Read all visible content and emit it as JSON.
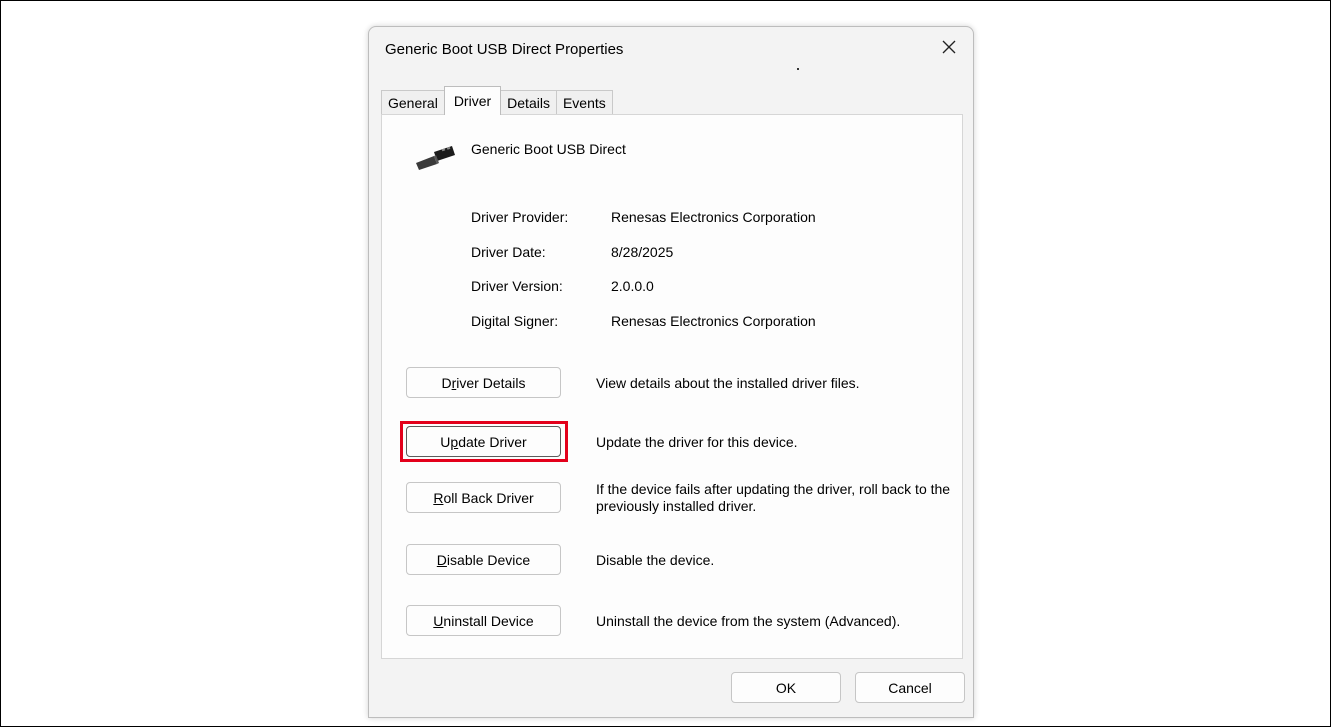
{
  "window": {
    "title": "Generic Boot USB Direct Properties"
  },
  "tabs": [
    {
      "label": "General",
      "active": false
    },
    {
      "label": "Driver",
      "active": true
    },
    {
      "label": "Details",
      "active": false
    },
    {
      "label": "Events",
      "active": false
    }
  ],
  "device": {
    "name": "Generic Boot USB Direct",
    "icon": "usb-connector-icon"
  },
  "properties": [
    {
      "label": "Driver Provider:",
      "value": "Renesas Electronics Corporation"
    },
    {
      "label": "Driver Date:",
      "value": "8/28/2025"
    },
    {
      "label": "Driver Version:",
      "value": "2.0.0.0"
    },
    {
      "label": "Digital Signer:",
      "value": "Renesas Electronics Corporation"
    }
  ],
  "actions": [
    {
      "pre": "D",
      "key": "r",
      "post": "iver Details",
      "description": "View details about the installed driver files."
    },
    {
      "pre": "U",
      "key": "p",
      "post": "date Driver",
      "description": "Update the driver for this device.",
      "highlighted": true
    },
    {
      "pre": "",
      "key": "R",
      "post": "oll Back Driver",
      "description": "If the device fails after updating the driver, roll back to the previously installed driver."
    },
    {
      "pre": "",
      "key": "D",
      "post": "isable Device",
      "description": "Disable the device."
    },
    {
      "pre": "",
      "key": "U",
      "post": "ninstall Device",
      "description": "Uninstall the device from the system (Advanced)."
    }
  ],
  "footer": {
    "ok_label": "OK",
    "cancel_label": "Cancel"
  },
  "colors": {
    "highlight_box": "#e3001b",
    "dialog_bg": "#f3f3f3",
    "panel_bg": "#fdfdfd"
  }
}
